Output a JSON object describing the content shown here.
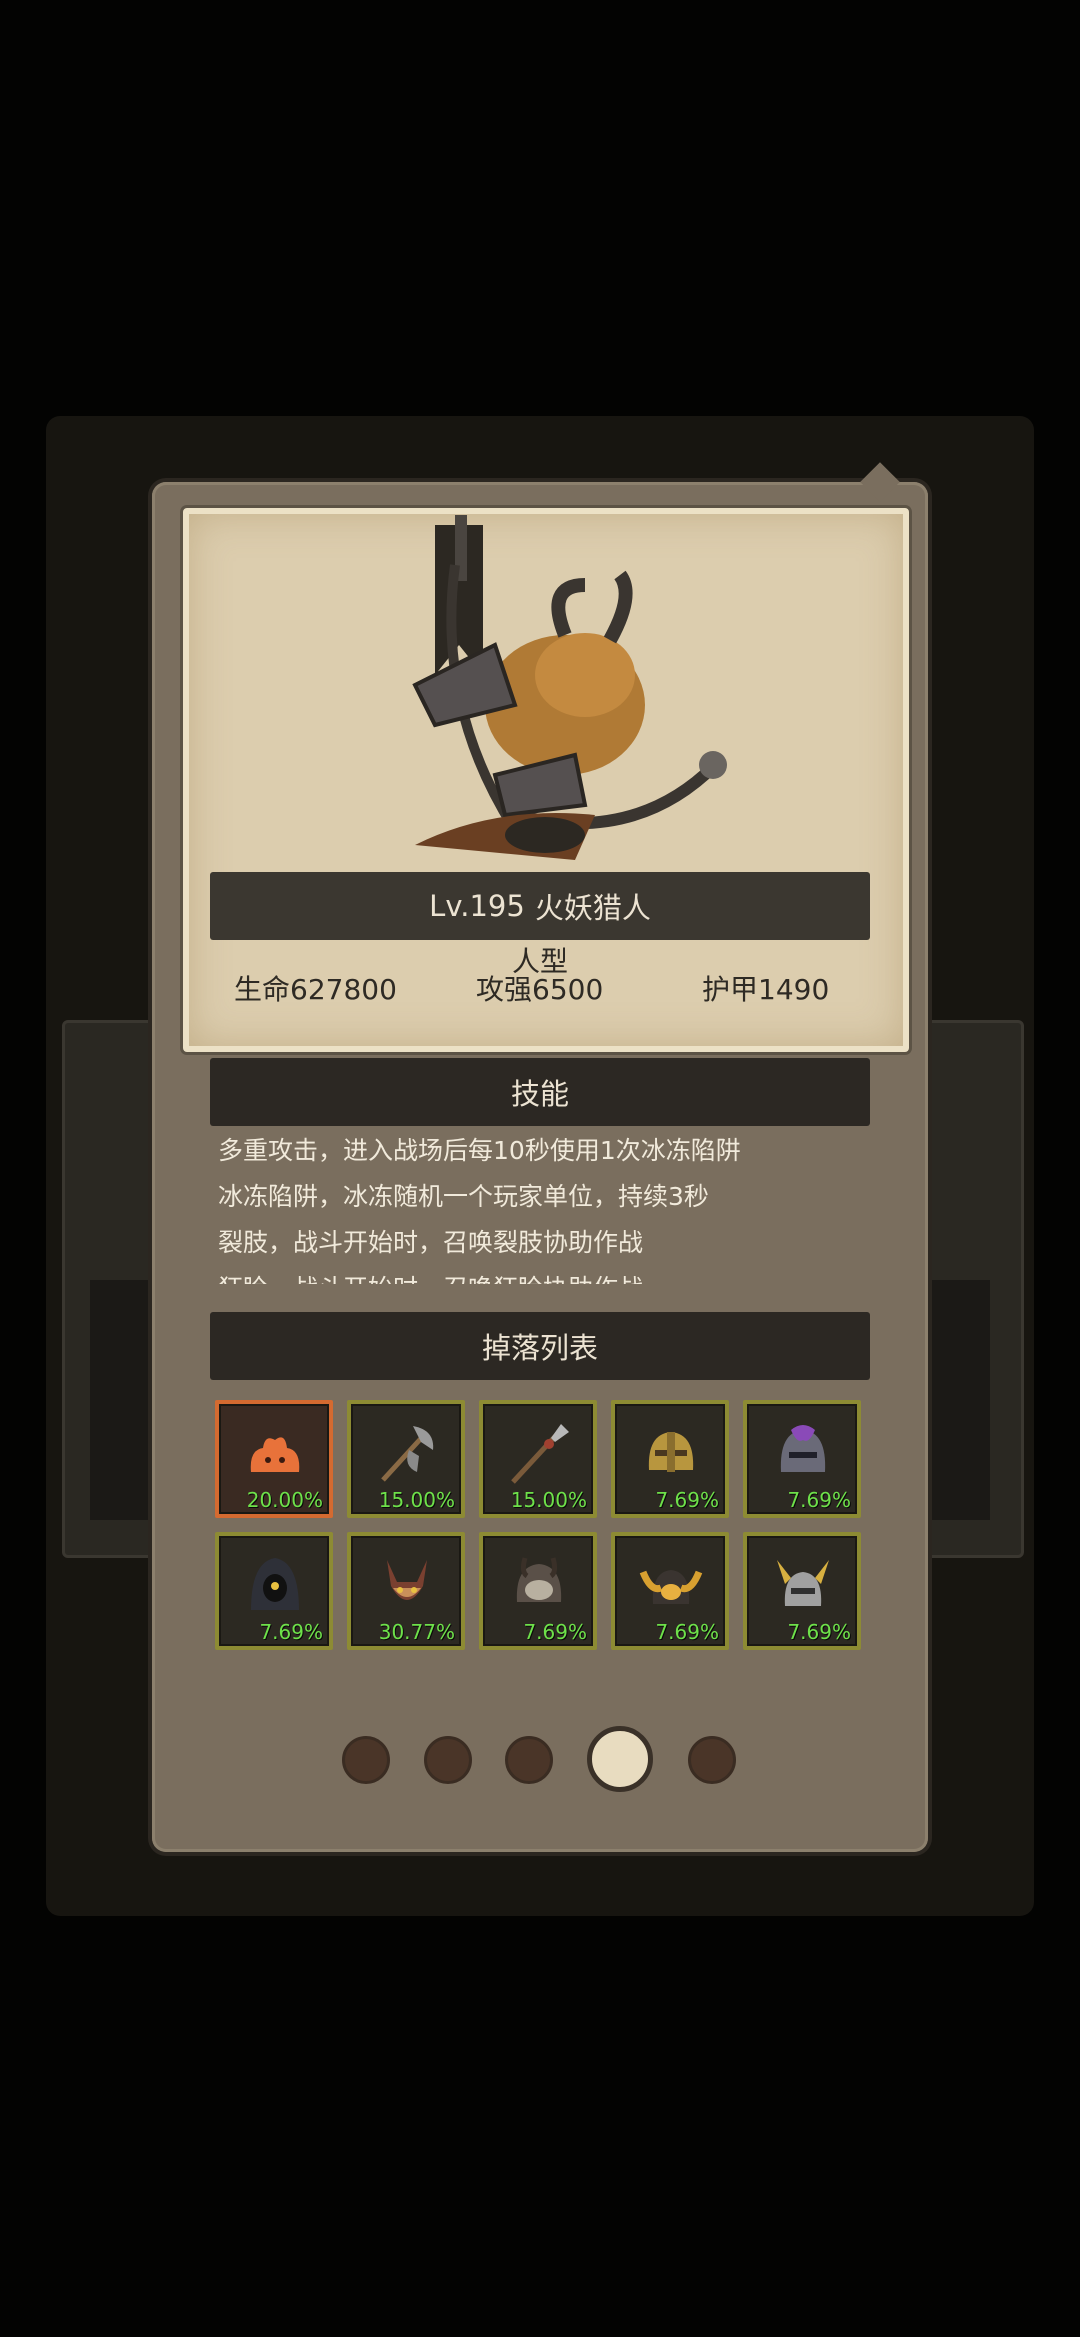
{
  "monster": {
    "name_level": "Lv.195",
    "name": "火妖猎人",
    "type": "人型",
    "stats": {
      "hp": "生命627800",
      "attack": "攻强6500",
      "armor": "护甲1490"
    }
  },
  "skills": {
    "title": "技能",
    "lines": [
      "多重攻击，进入战场后每10秒使用1次冰冻陷阱",
      "冰冻陷阱，冰冻随机一个玩家单位，持续3秒",
      "裂肢，战斗开始时，召唤裂肢协助作战",
      "狂睑，战斗开始时，召唤狂睑协助作战"
    ]
  },
  "drops": {
    "title": "掉落列表",
    "items": [
      {
        "icon": "fire-slime-icon",
        "pct": "20.00%",
        "rare": true
      },
      {
        "icon": "axe-icon",
        "pct": "15.00%",
        "rare": false
      },
      {
        "icon": "spear-icon",
        "pct": "15.00%",
        "rare": false
      },
      {
        "icon": "golden-helmet-icon",
        "pct": "7.69%",
        "rare": false
      },
      {
        "icon": "purple-helmet-icon",
        "pct": "7.69%",
        "rare": false
      },
      {
        "icon": "hood-icon",
        "pct": "7.69%",
        "rare": false
      },
      {
        "icon": "horned-mask-icon",
        "pct": "30.77%",
        "rare": false
      },
      {
        "icon": "skull-helmet-icon",
        "pct": "7.69%",
        "rare": false
      },
      {
        "icon": "flame-helmet-icon",
        "pct": "7.69%",
        "rare": false
      },
      {
        "icon": "winged-helmet-icon",
        "pct": "7.69%",
        "rare": false
      }
    ]
  },
  "pager": {
    "total": 5,
    "active_index": 3
  },
  "colors": {
    "drop_percent": "#6ee14a",
    "rare_border": "#d46a30",
    "normal_border": "#8d8b33"
  }
}
